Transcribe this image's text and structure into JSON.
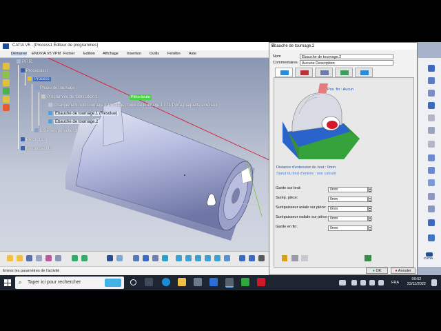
{
  "app": {
    "title": "CATIA V5 - [Process1 Éditeur de programmes]"
  },
  "menu": [
    "Démarrer",
    "ENOVIA V5 VPM",
    "Fichier",
    "Edition",
    "Affichage",
    "Insertion",
    "Outils",
    "Fenêtre",
    "Aide"
  ],
  "tree": {
    "ppr": "P.P.R.",
    "process_list": "ProcessList",
    "process": "Process",
    "phase": "Phase de tournage",
    "program": "Programme de fabrication.1",
    "tool_change": "Changement outil tournage.1  Montage d'outil de tournage.1 / T1 Porte-plaquette extérieur",
    "rough1": "Ebauche de tournage.1 (Résolue)",
    "rough2": "Ebauche de tournage.2",
    "procedures": "Liste des procédés.1",
    "product_list": "ProductList",
    "resources_list": "ResourcesList"
  },
  "viewport": {
    "part_label": "Pièce brute"
  },
  "status_bar": "Entrez les paramètres de l'activité",
  "dialog": {
    "title": "Ebauche de tournage.2",
    "help": "?",
    "close": "×",
    "name_label": "Nom",
    "name_value": "Ebauche de tournage.2",
    "comment_label": "Commentaires",
    "comment_value": "Aucune Description",
    "pos_fin": "Pos. fin : Aucun",
    "distance": "Distance d'extension du brut : 0mm",
    "status": "Statut du brut d'entrée : non calculé",
    "params": [
      {
        "label": "Garde sur brut:",
        "value": "0mm"
      },
      {
        "label": "Surép. pièce:",
        "value": "0mm"
      },
      {
        "label": "Surépaisseur axiale sur pièce:",
        "value": "0mm"
      },
      {
        "label": "Surépaisseur radiale sur pièce:",
        "value": "0mm"
      },
      {
        "label": "Garde en fin:",
        "value": "0mm"
      }
    ],
    "ok": "OK",
    "cancel": "Annuler"
  },
  "right_toolbar": {
    "brand": "CATIA"
  },
  "taskbar": {
    "search_placeholder": "Taper ici pour rechercher",
    "lang": "FRA",
    "time": "09:52",
    "date": "23/11/2022"
  },
  "colors": {
    "viewport_bg": "#a7b1c7",
    "selection": "#3a6fd1",
    "part_label_bg": "#4fd24b",
    "green": "#2eaa3a",
    "blue": "#2a63c9",
    "red": "#d0192b"
  }
}
